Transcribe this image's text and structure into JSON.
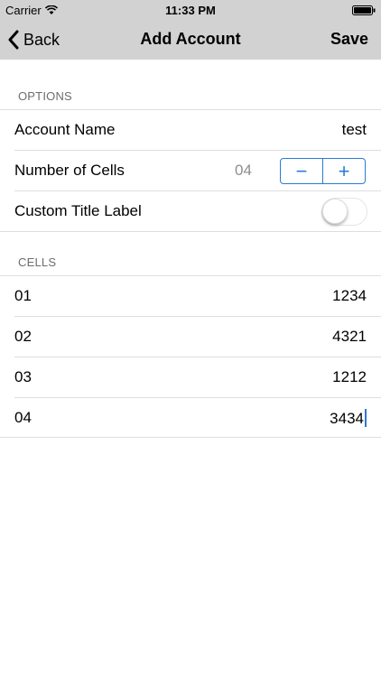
{
  "status_bar": {
    "carrier": "Carrier",
    "time": "11:33 PM"
  },
  "nav": {
    "back_label": "Back",
    "title": "Add Account",
    "save_label": "Save"
  },
  "options": {
    "header": "OPTIONS",
    "account_name_label": "Account Name",
    "account_name_value": "test",
    "cells_label": "Number of Cells",
    "cells_value": "04",
    "stepper_minus": "−",
    "stepper_plus": "+",
    "custom_title_label": "Custom Title Label",
    "custom_title_on": false
  },
  "cells": {
    "header": "CELLS",
    "rows": [
      {
        "label": "01",
        "value": "1234"
      },
      {
        "label": "02",
        "value": "4321"
      },
      {
        "label": "03",
        "value": "1212"
      },
      {
        "label": "04",
        "value": "3434"
      }
    ]
  },
  "colors": {
    "nav_bg": "#d2d2d2",
    "accent": "#2b7bd2",
    "separator": "#dedee2",
    "section_text": "#6d6d72"
  }
}
